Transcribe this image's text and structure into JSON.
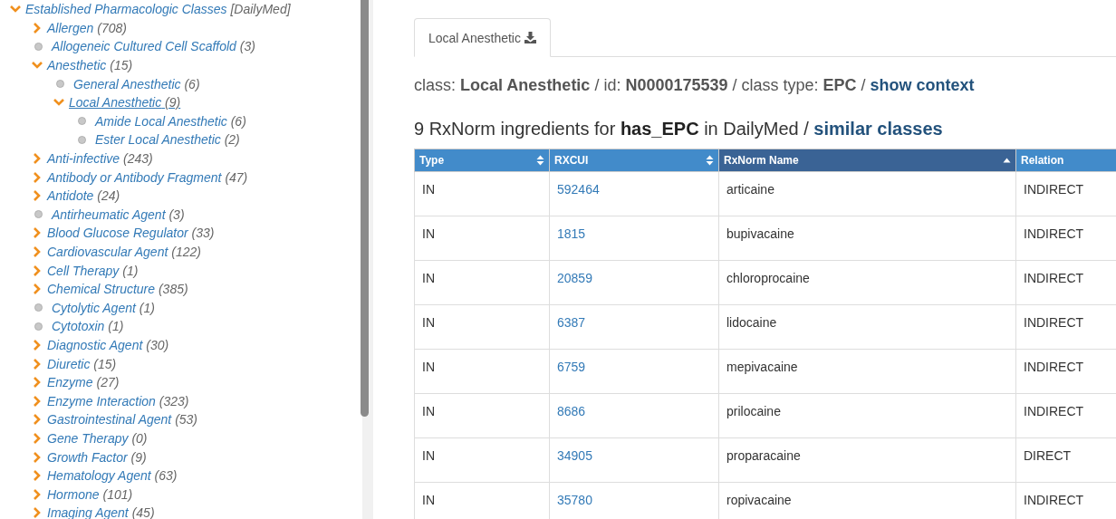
{
  "tree": {
    "label": "Established Pharmacologic Classes",
    "suffix": "[DailyMed]",
    "expanded": true,
    "selected": false,
    "kind": "branch",
    "children": [
      {
        "kind": "branch",
        "label": "Allergen",
        "count": "(708)",
        "expanded": false,
        "selected": false
      },
      {
        "kind": "leaf",
        "label": "Allogeneic Cultured Cell Scaffold",
        "count": "(3)",
        "selected": false
      },
      {
        "kind": "branch",
        "label": "Anesthetic",
        "count": "(15)",
        "expanded": true,
        "selected": false,
        "children": [
          {
            "kind": "leaf",
            "label": "General Anesthetic",
            "count": "(6)",
            "selected": false
          },
          {
            "kind": "branch",
            "label": "Local Anesthetic",
            "count": "(9)",
            "expanded": true,
            "selected": true,
            "children": [
              {
                "kind": "leaf",
                "label": "Amide Local Anesthetic",
                "count": "(6)",
                "selected": false
              },
              {
                "kind": "leaf",
                "label": "Ester Local Anesthetic",
                "count": "(2)",
                "selected": false
              }
            ]
          }
        ]
      },
      {
        "kind": "branch",
        "label": "Anti-infective",
        "count": "(243)",
        "expanded": false,
        "selected": false
      },
      {
        "kind": "branch",
        "label": "Antibody or Antibody Fragment",
        "count": "(47)",
        "expanded": false,
        "selected": false
      },
      {
        "kind": "branch",
        "label": "Antidote",
        "count": "(24)",
        "expanded": false,
        "selected": false
      },
      {
        "kind": "leaf",
        "label": "Antirheumatic Agent",
        "count": "(3)",
        "selected": false
      },
      {
        "kind": "branch",
        "label": "Blood Glucose Regulator",
        "count": "(33)",
        "expanded": false,
        "selected": false
      },
      {
        "kind": "branch",
        "label": "Cardiovascular Agent",
        "count": "(122)",
        "expanded": false,
        "selected": false
      },
      {
        "kind": "branch",
        "label": "Cell Therapy",
        "count": "(1)",
        "expanded": false,
        "selected": false
      },
      {
        "kind": "branch",
        "label": "Chemical Structure",
        "count": "(385)",
        "expanded": false,
        "selected": false
      },
      {
        "kind": "leaf",
        "label": "Cytolytic Agent",
        "count": "(1)",
        "selected": false
      },
      {
        "kind": "leaf",
        "label": "Cytotoxin",
        "count": "(1)",
        "selected": false
      },
      {
        "kind": "branch",
        "label": "Diagnostic Agent",
        "count": "(30)",
        "expanded": false,
        "selected": false
      },
      {
        "kind": "branch",
        "label": "Diuretic",
        "count": "(15)",
        "expanded": false,
        "selected": false
      },
      {
        "kind": "branch",
        "label": "Enzyme",
        "count": "(27)",
        "expanded": false,
        "selected": false
      },
      {
        "kind": "branch",
        "label": "Enzyme Interaction",
        "count": "(323)",
        "expanded": false,
        "selected": false
      },
      {
        "kind": "branch",
        "label": "Gastrointestinal Agent",
        "count": "(53)",
        "expanded": false,
        "selected": false
      },
      {
        "kind": "branch",
        "label": "Gene Therapy",
        "count": "(0)",
        "expanded": false,
        "selected": false
      },
      {
        "kind": "branch",
        "label": "Growth Factor",
        "count": "(9)",
        "expanded": false,
        "selected": false
      },
      {
        "kind": "branch",
        "label": "Hematology Agent",
        "count": "(63)",
        "expanded": false,
        "selected": false
      },
      {
        "kind": "branch",
        "label": "Hormone",
        "count": "(101)",
        "expanded": false,
        "selected": false
      },
      {
        "kind": "branch",
        "label": "Imaging Agent",
        "count": "(45)",
        "expanded": false,
        "selected": false
      }
    ]
  },
  "tab": {
    "label": "Local Anesthetic",
    "selected": true
  },
  "info": {
    "text": "class: **Local Anesthetic** / id: **N0000175539** / class type: **EPC** / ",
    "link": "show context"
  },
  "heading": {
    "text": "9 RxNorm ingredients for **has_EPC** in DailyMed / ",
    "link": "similar classes"
  },
  "table": {
    "columns": [
      {
        "label": "Type",
        "kind": "sortable"
      },
      {
        "label": "RXCUI",
        "kind": "sortable"
      },
      {
        "label": "RxNorm Name",
        "kind": "ascending"
      },
      {
        "label": "Relation",
        "kind": "plain"
      }
    ],
    "rows": [
      [
        "IN",
        "592464",
        "articaine",
        "INDIRECT"
      ],
      [
        "IN",
        "1815",
        "bupivacaine",
        "INDIRECT"
      ],
      [
        "IN",
        "20859",
        "chloroprocaine",
        "INDIRECT"
      ],
      [
        "IN",
        "6387",
        "lidocaine",
        "INDIRECT"
      ],
      [
        "IN",
        "6759",
        "mepivacaine",
        "INDIRECT"
      ],
      [
        "IN",
        "8686",
        "prilocaine",
        "INDIRECT"
      ],
      [
        "IN",
        "34905",
        "proparacaine",
        "DIRECT"
      ],
      [
        "IN",
        "35780",
        "ropivacaine",
        "INDIRECT"
      ]
    ]
  }
}
